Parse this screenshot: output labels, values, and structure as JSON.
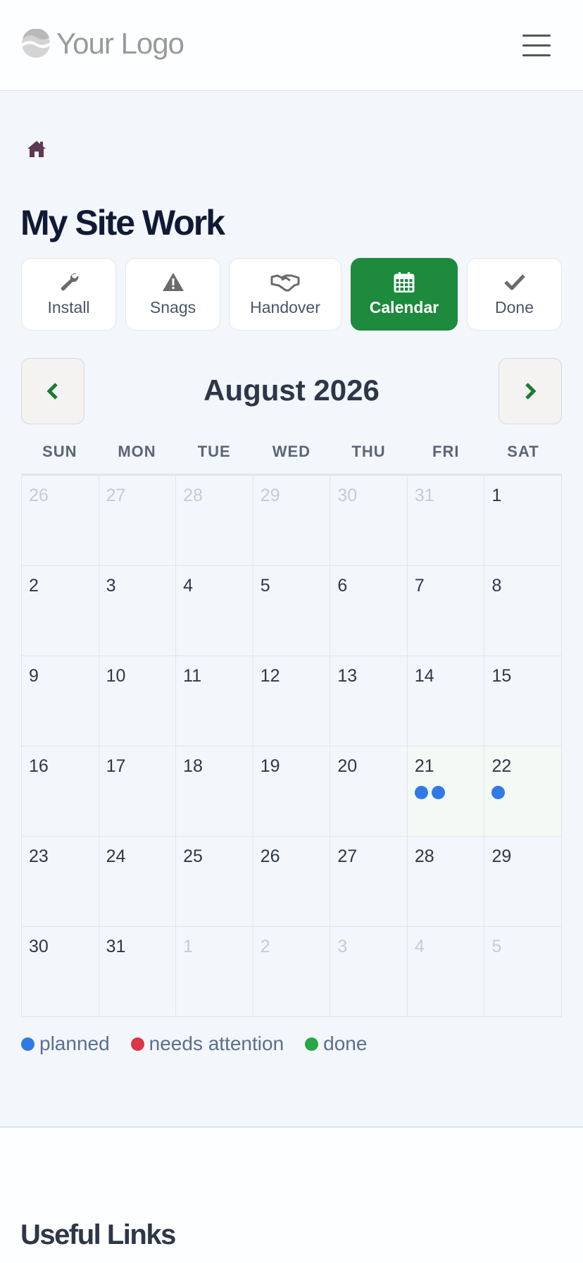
{
  "header": {
    "logo_text": "Your Logo",
    "logo_icon": "logo-icon",
    "menu_icon": "hamburger-menu-icon"
  },
  "breadcrumb": {
    "home_icon": "home-icon"
  },
  "page_title": "My Site Work",
  "tabs": [
    {
      "label": "Install",
      "icon": "wrench-icon",
      "active": false
    },
    {
      "label": "Snags",
      "icon": "warning-icon",
      "active": false
    },
    {
      "label": "Handover",
      "icon": "handshake-icon",
      "active": false
    },
    {
      "label": "Calendar",
      "icon": "calendar-icon",
      "active": true
    },
    {
      "label": "Done",
      "icon": "check-icon",
      "active": false
    }
  ],
  "calendar": {
    "month_title": "August 2026",
    "prev_icon": "chevron-left-icon",
    "next_icon": "chevron-right-icon",
    "weekdays": [
      "SUN",
      "MON",
      "TUE",
      "WED",
      "THU",
      "FRI",
      "SAT"
    ],
    "weeks": [
      [
        {
          "d": "26",
          "other": true
        },
        {
          "d": "27",
          "other": true
        },
        {
          "d": "28",
          "other": true
        },
        {
          "d": "29",
          "other": true
        },
        {
          "d": "30",
          "other": true
        },
        {
          "d": "31",
          "other": true
        },
        {
          "d": "1"
        }
      ],
      [
        {
          "d": "2"
        },
        {
          "d": "3"
        },
        {
          "d": "4"
        },
        {
          "d": "5"
        },
        {
          "d": "6"
        },
        {
          "d": "7"
        },
        {
          "d": "8"
        }
      ],
      [
        {
          "d": "9"
        },
        {
          "d": "10"
        },
        {
          "d": "11"
        },
        {
          "d": "12"
        },
        {
          "d": "13"
        },
        {
          "d": "14"
        },
        {
          "d": "15"
        }
      ],
      [
        {
          "d": "16"
        },
        {
          "d": "17"
        },
        {
          "d": "18"
        },
        {
          "d": "19"
        },
        {
          "d": "20"
        },
        {
          "d": "21",
          "events": [
            "planned",
            "planned"
          ]
        },
        {
          "d": "22",
          "events": [
            "planned"
          ]
        }
      ],
      [
        {
          "d": "23"
        },
        {
          "d": "24"
        },
        {
          "d": "25"
        },
        {
          "d": "26"
        },
        {
          "d": "27"
        },
        {
          "d": "28"
        },
        {
          "d": "29"
        }
      ],
      [
        {
          "d": "30"
        },
        {
          "d": "31"
        },
        {
          "d": "1",
          "other": true
        },
        {
          "d": "2",
          "other": true
        },
        {
          "d": "3",
          "other": true
        },
        {
          "d": "4",
          "other": true
        },
        {
          "d": "5",
          "other": true
        }
      ]
    ]
  },
  "legend": [
    {
      "key": "planned",
      "label": "planned",
      "color": "#2f7ae5"
    },
    {
      "key": "attention",
      "label": "needs attention",
      "color": "#dc3545"
    },
    {
      "key": "done",
      "label": "done",
      "color": "#28a745"
    }
  ],
  "useful_links": {
    "title": "Useful Links"
  },
  "colors": {
    "accent": "#1d8a3e",
    "planned": "#2f7ae5",
    "attention": "#dc3545",
    "done": "#28a745",
    "title": "#101a36"
  }
}
